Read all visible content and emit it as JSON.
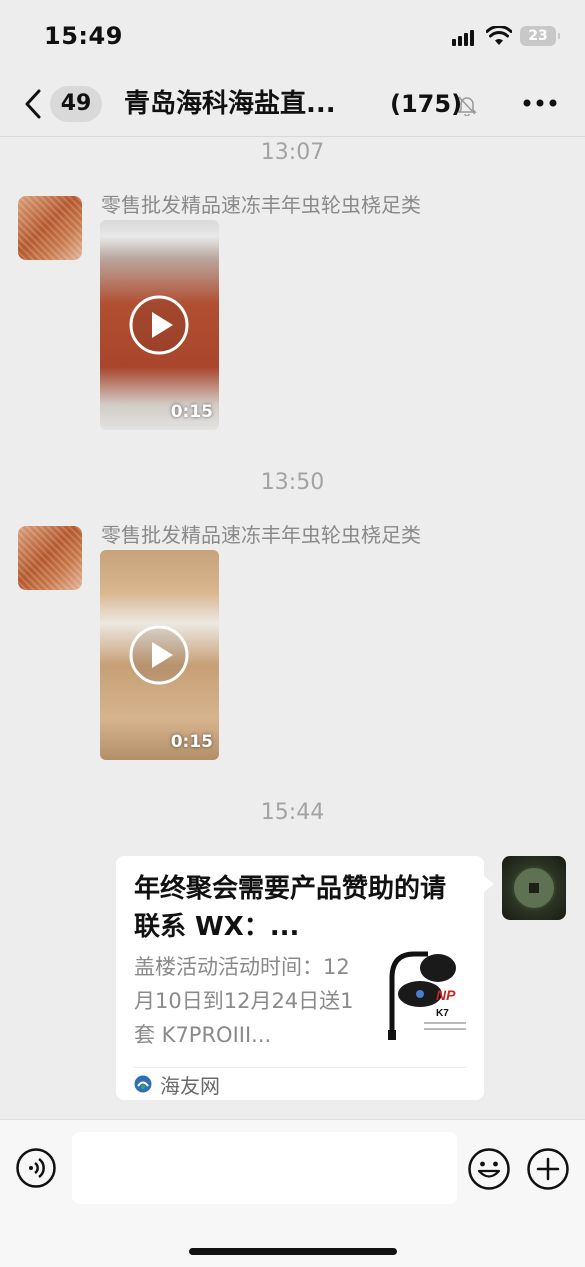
{
  "status_bar": {
    "time": "15:49",
    "battery": "23"
  },
  "header": {
    "unread_count": "49",
    "title": "青岛海科海盐直...",
    "member_count": "(175)"
  },
  "messages": [
    {
      "type": "timestamp",
      "text": "13:07"
    },
    {
      "type": "video",
      "sender": "零售批发精品速冻丰年虫轮虫桡足类",
      "duration": "0:15"
    },
    {
      "type": "timestamp",
      "text": "13:50"
    },
    {
      "type": "video",
      "sender": "零售批发精品速冻丰年虫轮虫桡足类",
      "duration": "0:15"
    },
    {
      "type": "timestamp",
      "text": "15:44"
    },
    {
      "type": "link_card",
      "title": "年终聚会需要产品赞助的请联系 WX：...",
      "description": "盖楼活动活动时间：12月10日到12月24日送1套 K7PROIII...",
      "source": "海友网",
      "thumbnail_text": "K7"
    }
  ],
  "icons": {
    "back": "chevron-left-icon",
    "mute": "bell-slash-icon",
    "more": "more-dots-icon",
    "play": "play-icon",
    "voice": "voice-icon",
    "emoji": "emoji-icon",
    "plus": "plus-icon",
    "source": "source-logo-icon"
  },
  "colors": {
    "background": "#ededed",
    "card": "#ffffff",
    "timestamp": "#a3a3a3",
    "sender": "#8a8a8a"
  }
}
